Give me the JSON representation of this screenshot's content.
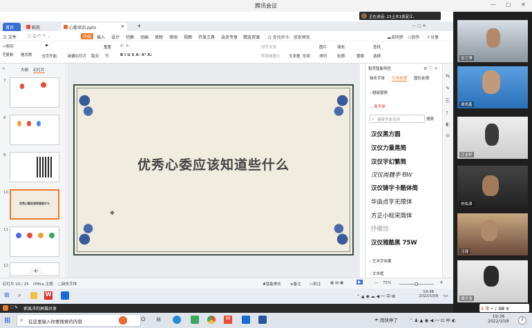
{
  "meeting": {
    "title": "腾讯会议",
    "speaking": "正在讲话: 22土木1张定江;",
    "window_controls": [
      "—",
      "▢",
      "✕"
    ]
  },
  "tabs": [
    {
      "label": "首页"
    },
    {
      "label": "稻壳"
    },
    {
      "label": "心委培训.pptx"
    },
    {
      "label": "+"
    }
  ],
  "menubar": {
    "file": "三 文件",
    "start": "开始",
    "items": [
      "插入",
      "设计",
      "切换",
      "动画",
      "放映",
      "审阅",
      "视图",
      "开发工具",
      "会员专享",
      "精选资源"
    ],
    "search": "Q 查找命令、搜索模板",
    "sync": "未同步",
    "collab": "协作",
    "share": "分享"
  },
  "ribbon": {
    "cut": "剪切",
    "copy": "复制",
    "format": "格式刷",
    "paste": "粘贴",
    "playfrom": "当页开始",
    "newslide": "新建幻灯片",
    "layout": "版式",
    "section": "节",
    "reset": "重置",
    "align": "对齐文本",
    "textbox": "文本框",
    "shape": "形状",
    "arrange": "排列",
    "outline": "轮廓",
    "find": "查找",
    "replace": "替换",
    "select": "选择",
    "pic": "图片",
    "fill": "填充",
    "smartart": "转换成图示",
    "font_size_hint": "A⁺ A⁻",
    "bold_row": "B I U S A· X² X₂"
  },
  "thumbpane": {
    "tab_outline": "大纲",
    "tab_slides": "幻灯片",
    "slides": [
      {
        "num": "7"
      },
      {
        "num": "8"
      },
      {
        "num": "9"
      },
      {
        "num": "10",
        "text": "优秀心委应该知道些什么"
      },
      {
        "num": "11"
      },
      {
        "num": "12"
      }
    ],
    "add": "+"
  },
  "slide": {
    "title": "优秀心委应该知道些什么"
  },
  "fontpane": {
    "header": "稻壳智能特性",
    "tabs": [
      "缺失字体",
      "文本处理",
      "图形处理"
    ],
    "section_replace": "› 超级替换",
    "section_font": "⌄ 新字体",
    "search_placeholder": "搜索字体名称",
    "search_btn": "搜索",
    "fonts": [
      "汉仪黑方圆",
      "汉仪力量黑简",
      "汉仪字幻繁简",
      "汉仪尚魏手书W",
      "汉仪铸字卡酷体简",
      "华由点字无限体",
      "方正小标宋简体",
      "抒雁饺",
      "汉仪雅酷黑 75W"
    ],
    "section_effect": "› 艺术字效果",
    "section_textframe": "› 文本框"
  },
  "statusbar": {
    "slide_count": "幻灯片 10 / 25",
    "theme": "Office 主题",
    "missing_font": "缺失字体",
    "beautify": "智能美化",
    "notes": "备注",
    "comments": "批注",
    "zoom": "75%",
    "plus": "+",
    "minus": "—"
  },
  "inner_taskbar": {
    "time": "19:38",
    "date": "2022/10/8",
    "lang": "中"
  },
  "share_banner": {
    "text": "郭禹洋的屏幕共享"
  },
  "outer_taskbar": {
    "search": "在这里输入你要搜索的内容",
    "weather": "雨快停了",
    "time": "19:38",
    "date": "2022/10/8",
    "lang": "中",
    "notif": "2"
  },
  "participants": [
    {
      "name": "张艺博"
    },
    {
      "name": "谢尚鑫"
    },
    {
      "name": "江志轩"
    },
    {
      "name": "刘佑涛"
    },
    {
      "name": "汪瑾"
    },
    {
      "name": "谢文浩"
    }
  ],
  "colors": {
    "accent_orange": "#f0782c",
    "slide_bg": "#f1ece0",
    "meeting_bar": "#f3f3f3",
    "video_bg": "#1f1f1f"
  }
}
